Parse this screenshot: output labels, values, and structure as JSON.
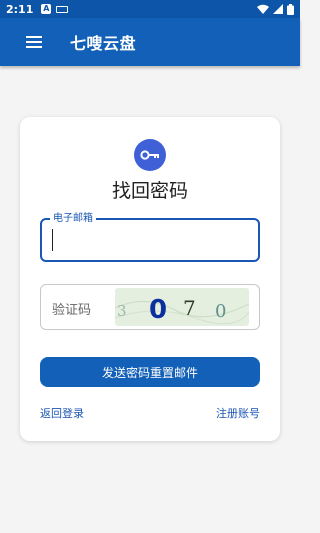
{
  "status_bar": {
    "time": "2:11",
    "app_icon_letter": "A"
  },
  "app_bar": {
    "title": "七嗖云盘",
    "menu_icon": "hamburger-menu-icon"
  },
  "card": {
    "icon": "key-icon",
    "title": "找回密码",
    "email": {
      "label": "电子邮箱",
      "value": ""
    },
    "captcha": {
      "label": "验证码",
      "value": "",
      "code": [
        "3",
        "0",
        "7",
        "0"
      ]
    },
    "send_button": "发送密码重置邮件",
    "back_link": "返回登录",
    "register_link": "注册账号"
  },
  "colors": {
    "primary": "#1260b8",
    "status_bar": "#0d55a8",
    "key_badge": "#3f60d6",
    "captcha_bg": "#e4efe0"
  }
}
